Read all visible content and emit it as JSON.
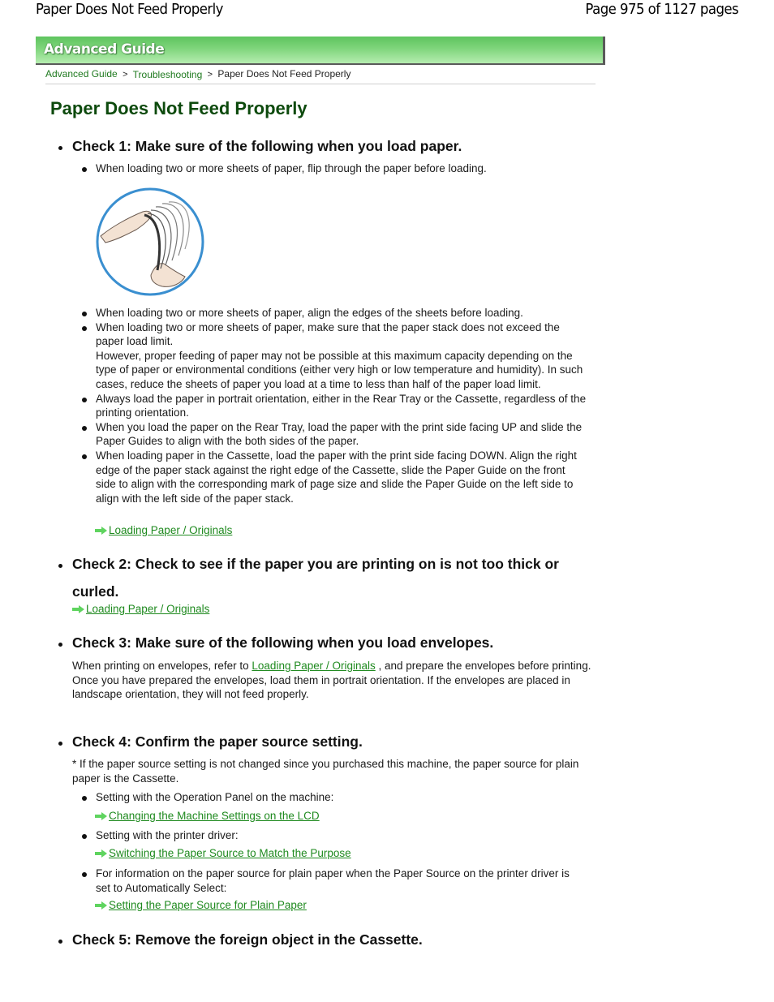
{
  "header": {
    "doc_title": "Paper Does Not Feed Properly",
    "page_indicator": "Page 975 of 1127 pages"
  },
  "banner": {
    "label": "Advanced Guide",
    "color": "#6cc96a"
  },
  "breadcrumb": {
    "items": [
      "Advanced Guide",
      "Troubleshooting",
      "Paper Does Not Feed Properly"
    ],
    "separator": ">"
  },
  "title": "Paper Does Not Feed Properly",
  "link_color": "#1f8a1f",
  "checks": [
    {
      "heading": "Check 1: Make sure of the following when you load paper.",
      "bullets_before_image": [
        "When loading two or more sheets of paper, flip through the paper before loading."
      ],
      "image": {
        "icon": "flipping-paper-illustration",
        "alt": "Hands flipping through a stack of paper"
      },
      "bullets": [
        "When loading two or more sheets of paper, align the edges of the sheets before loading.",
        "When loading two or more sheets of paper, make sure that the paper stack does not exceed the paper load limit.",
        "However, proper feeding of paper may not be possible at this maximum capacity depending on the type of paper or environmental conditions (either very high or low temperature and humidity). In such cases, reduce the sheets of paper you load at a time to less than half of the paper load limit.",
        "Always load the paper in portrait orientation, either in the Rear Tray or the Cassette, regardless of the printing orientation.",
        "When you load the paper on the Rear Tray, load the paper with the print side facing UP and slide the Paper Guides to align with the both sides of the paper.",
        "When loading paper in the Cassette, load the paper with the print side facing DOWN. Align the right edge of the paper stack against the right edge of the Cassette, slide the Paper Guide on the front side to align with the corresponding mark of page size and slide the Paper Guide on the left side to align with the left side of the paper stack."
      ],
      "link": "Loading Paper / Originals"
    },
    {
      "heading_line1": "Check 2: Check to see if the paper you are printing on is not too thick or",
      "heading_line2": "curled.",
      "link": "Loading Paper / Originals"
    },
    {
      "heading": "Check 3: Make sure of the following when you load envelopes.",
      "para1_before": "When printing on envelopes, refer to",
      "para1_link": "Loading Paper / Originals",
      "para1_after": ", and prepare the envelopes before printing.",
      "para2": "Once you have prepared the envelopes, load them in portrait orientation. If the envelopes are placed in landscape orientation, they will not feed properly."
    },
    {
      "heading": "Check 4: Confirm the paper source setting.",
      "note": "* If the paper source setting is not changed since you purchased this machine, the paper source for plain paper is the Cassette.",
      "items": [
        {
          "text": "Setting with the Operation Panel on the machine:",
          "link": "Changing the Machine Settings on the LCD"
        },
        {
          "text": "Setting with the printer driver:",
          "link": "Switching the Paper Source to Match the Purpose"
        },
        {
          "text": "For information on the paper source for plain paper when the Paper Source on the printer driver is set to Automatically Select:",
          "link": "Setting the Paper Source for Plain Paper"
        }
      ]
    },
    {
      "heading": "Check 5: Remove the foreign object in the Cassette."
    }
  ]
}
